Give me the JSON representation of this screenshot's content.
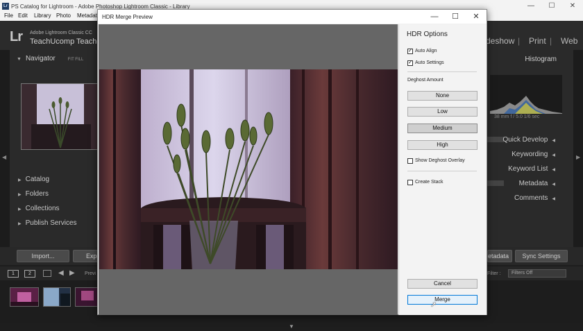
{
  "window": {
    "icon_text": "Lr",
    "title": "PS Catalog for Lightroom - Adobe Photoshop Lightroom Classic - Library",
    "minimize": "—",
    "maximize": "☐",
    "close": "✕"
  },
  "menu": [
    "File",
    "Edit",
    "Library",
    "Photo",
    "Metadata"
  ],
  "lightroom": {
    "logo": "Lr",
    "product": "Adobe Lightroom Classic CC",
    "identity": "TeachUcomp Teache",
    "modules": [
      "deshow",
      "Print",
      "Web"
    ],
    "module_separators": [
      "|",
      "|"
    ]
  },
  "left_panel": {
    "navigator_title": "Navigator",
    "navigator_zoom": "FIT   FILL",
    "sections": [
      "Catalog",
      "Folders",
      "Collections",
      "Publish Services"
    ]
  },
  "right_panel": {
    "histogram_title": "Histogram",
    "histogram_info": "38 mm     f / 5.0     1/6 sec",
    "sections": [
      "Quick Develop",
      "Keywording",
      "Keyword List",
      "Metadata",
      "Comments"
    ]
  },
  "toolbar": {
    "import_label": "Import...",
    "export_label": "Exp",
    "metadata_label": "etadata",
    "sync_settings_label": "Sync Settings"
  },
  "filmstrip": {
    "view1": "1",
    "view2": "2",
    "prev_label": "Previ",
    "filter_label": "Filter :",
    "filter_value": "Filters Off"
  },
  "dialog": {
    "title": "HDR Merge Preview",
    "minimize": "—",
    "maximize": "☐",
    "close": "✕",
    "options_title": "HDR Options",
    "auto_align": {
      "label": "Auto Align",
      "checked": true
    },
    "auto_settings": {
      "label": "Auto Settings",
      "checked": true
    },
    "deghost_label": "Deghost Amount",
    "deghost_options": [
      "None",
      "Low",
      "Medium",
      "High"
    ],
    "deghost_selected": "Medium",
    "show_overlay": {
      "label": "Show Deghost Overlay",
      "checked": false
    },
    "create_stack": {
      "label": "Create Stack",
      "checked": false
    },
    "cancel_label": "Cancel",
    "merge_label": "Merge"
  },
  "colors": {
    "dialog_bg": "#f0f0f0",
    "preview_bg": "#666666",
    "lr_panel": "#2a2a2a",
    "primary_border": "#0078d7"
  }
}
